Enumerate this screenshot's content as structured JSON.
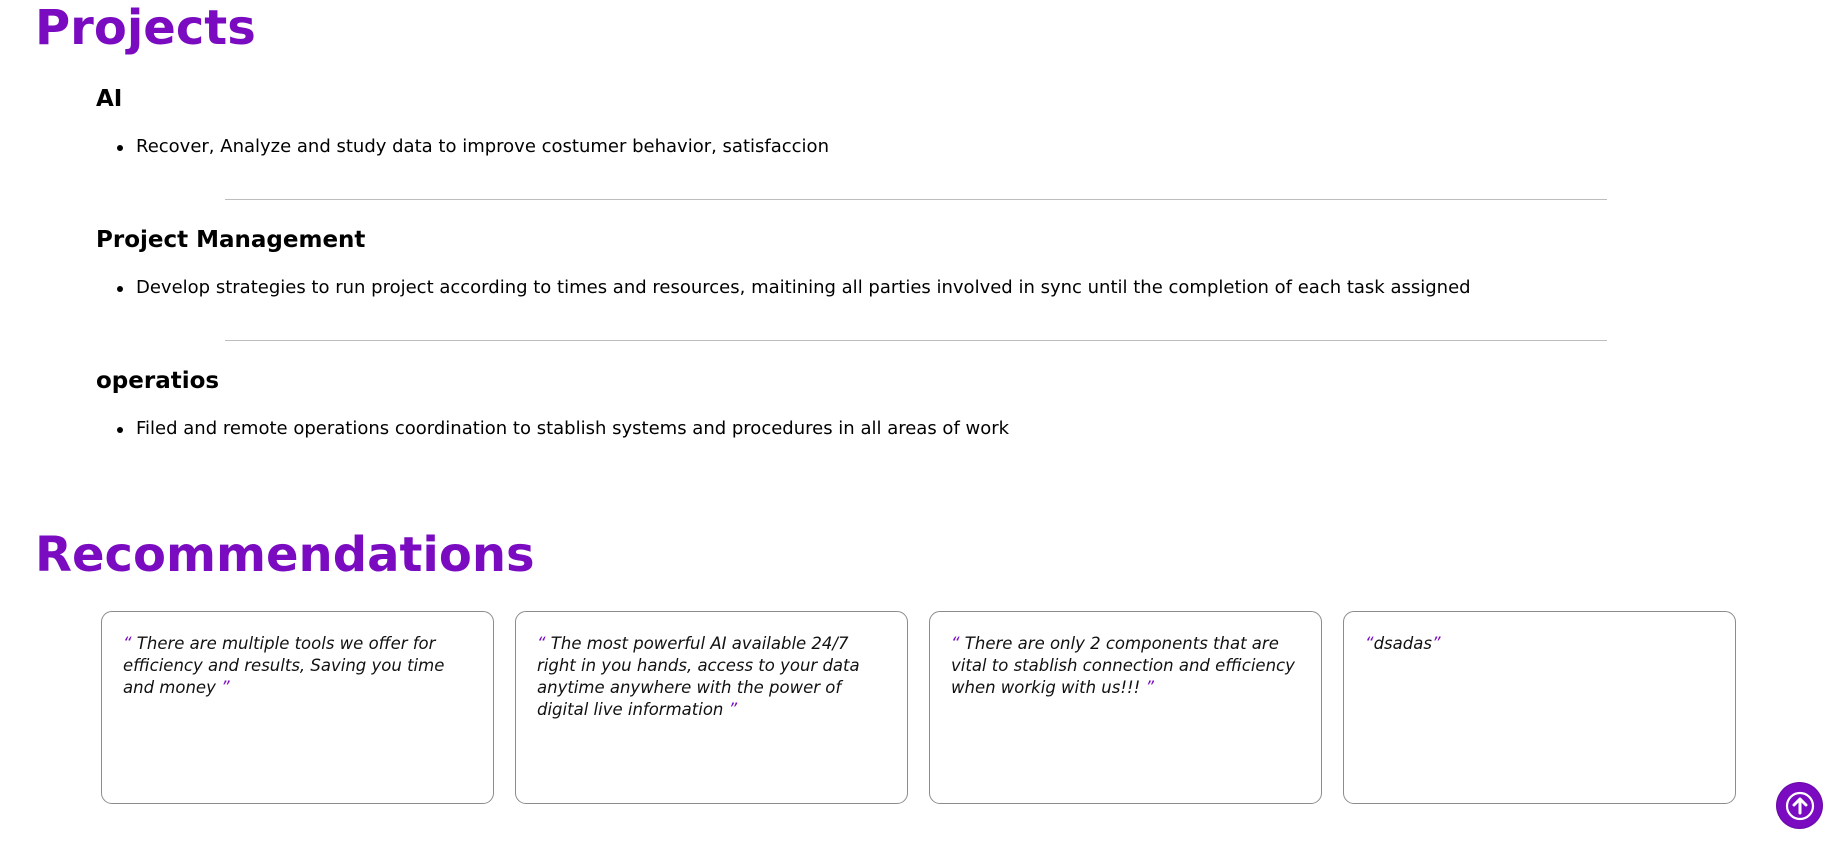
{
  "projects": {
    "title": "Projects",
    "items": [
      {
        "heading": "AI",
        "bullet": "Recover, Analyze and study data to improve costumer behavior, satisfaccion"
      },
      {
        "heading": "Project Management",
        "bullet": "Develop strategies to run project according to times and resources, maitining all parties involved in sync until the completion of each task assigned"
      },
      {
        "heading": "operatios",
        "bullet": "Filed and remote operations coordination to stablish systems and procedures in all areas of work"
      }
    ]
  },
  "recommendations": {
    "title": "Recommendations",
    "open_quote": "“",
    "close_quote": "”",
    "items": [
      {
        "text": " There are multiple tools we offer for efficiency and results, Saving you time and money "
      },
      {
        "text": " The most powerful AI available 24/7 right in you hands, access to your data anytime anywhere with the power of digital live information "
      },
      {
        "text": " There are only 2 components that are vital to stablish connection and efficiency when workig with us!!! "
      },
      {
        "text": "dsadas"
      }
    ]
  },
  "scroll_top": {
    "icon": "arrow-up-circle-icon"
  },
  "colors": {
    "accent": "#7a0bc0",
    "divider": "#bdbdbd",
    "card_border": "#8c8c8c"
  }
}
